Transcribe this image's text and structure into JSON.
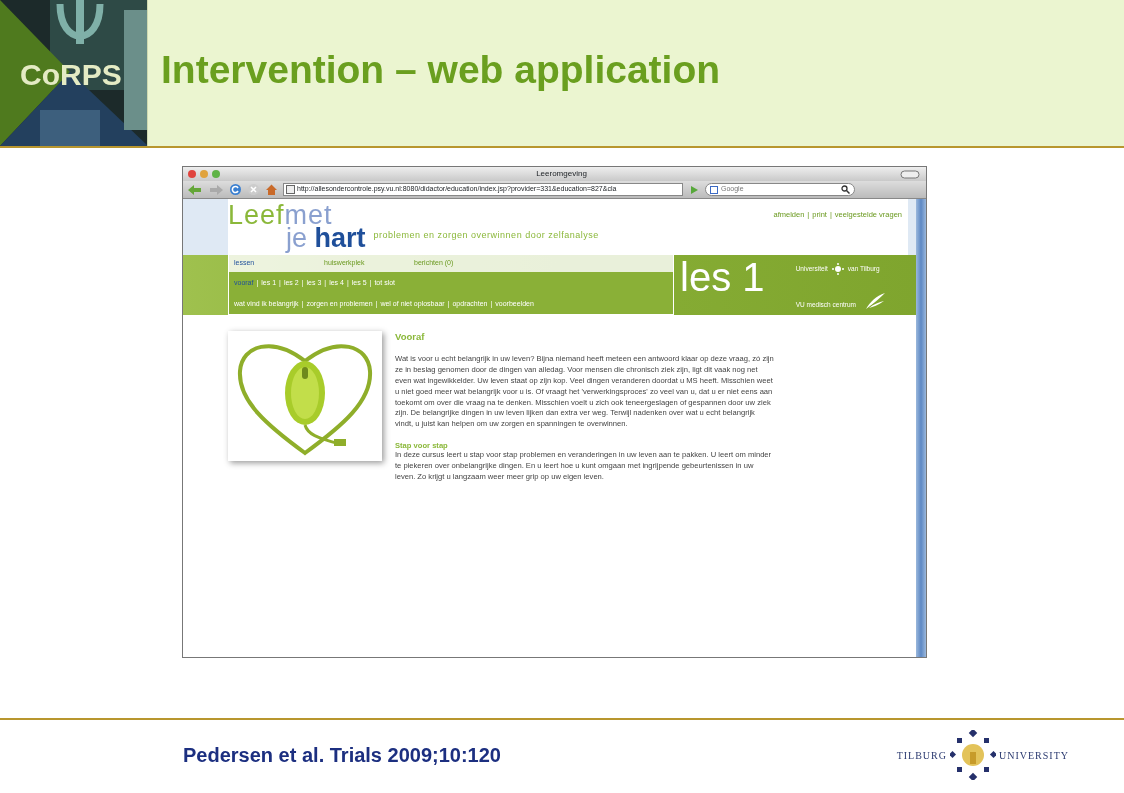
{
  "slide": {
    "logo_text": "CoRPS",
    "title": "Intervention – web application",
    "citation": "Pedersen et al. Trials 2009;10:120",
    "university_left": "TILBURG",
    "university_right": "UNIVERSITY"
  },
  "browser": {
    "title": "Leeromgeving",
    "url": "http://allesondercontrole.psy.vu.nl:8080/didactor/education/index.jsp?provider=331&education=827&cla",
    "search_placeholder": "Google"
  },
  "site": {
    "logo_a": "Leef",
    "logo_b": "met",
    "logo_c": "je",
    "logo_d": "hart",
    "tagline": "problemen en zorgen overwinnen door zelfanalyse",
    "separator": "|",
    "top_links": [
      "afmelden",
      "print",
      "veelgestelde vragen"
    ],
    "main_tabs": [
      {
        "label": "lessen",
        "selected": true
      },
      {
        "label": "huiswerkplek",
        "selected": false
      },
      {
        "label": "berichten (0)",
        "selected": false
      }
    ],
    "lesson_tabs": [
      {
        "label": "vooraf",
        "selected": true
      },
      {
        "label": "les 1",
        "selected": false
      },
      {
        "label": "les 2",
        "selected": false
      },
      {
        "label": "les 3",
        "selected": false
      },
      {
        "label": "les 4",
        "selected": false
      },
      {
        "label": "les 5",
        "selected": false
      },
      {
        "label": "tot slot",
        "selected": false
      }
    ],
    "sub_links": [
      "wat vind ik belangrijk",
      "zorgen en problemen",
      "wel of niet oplosbaar",
      "opdrachten",
      "voorbeelden"
    ],
    "banner_title": "les 1",
    "partner_a_left": "Universiteit",
    "partner_a_right": "van Tilburg",
    "partner_b": "VU medisch centrum"
  },
  "content": {
    "sections": [
      {
        "heading": "Vooraf",
        "text": "Wat is voor u echt belangrijk in uw leven? Bijna niemand heeft meteen een antwoord klaar op deze vraag, zó zijn ze in beslag genomen door de dingen van alledag. Voor mensen die chronisch ziek zijn, ligt dit vaak nog net even wat ingewikkelder. Uw leven staat op zijn kop. Veel dingen veranderen doordat u MS heeft. Misschien weet u niet goed meer wat belangrijk voor u is. Of vraagt het 'verwerkingsproces' zo veel van u, dat u er niet eens aan toekomt om over die vraag na te denken. Misschien voelt u zich ook teneergeslagen of gespannen door uw ziek zijn. De belangrijke dingen in uw leven lijken dan extra ver weg. Terwijl nadenken over wat u echt belangrijk vindt, u juist kan helpen om uw zorgen en spanningen te overwinnen."
      },
      {
        "heading": "Stap voor stap",
        "text": "In deze cursus leert u stap voor stap problemen en veranderingen in uw leven aan te pakken. U leert om minder te piekeren over onbelangrijke dingen. En u leert hoe u kunt omgaan met ingrijpende gebeurtenissen in uw leven. Zo krijgt u langzaam weer meer grip op uw eigen leven."
      }
    ]
  }
}
